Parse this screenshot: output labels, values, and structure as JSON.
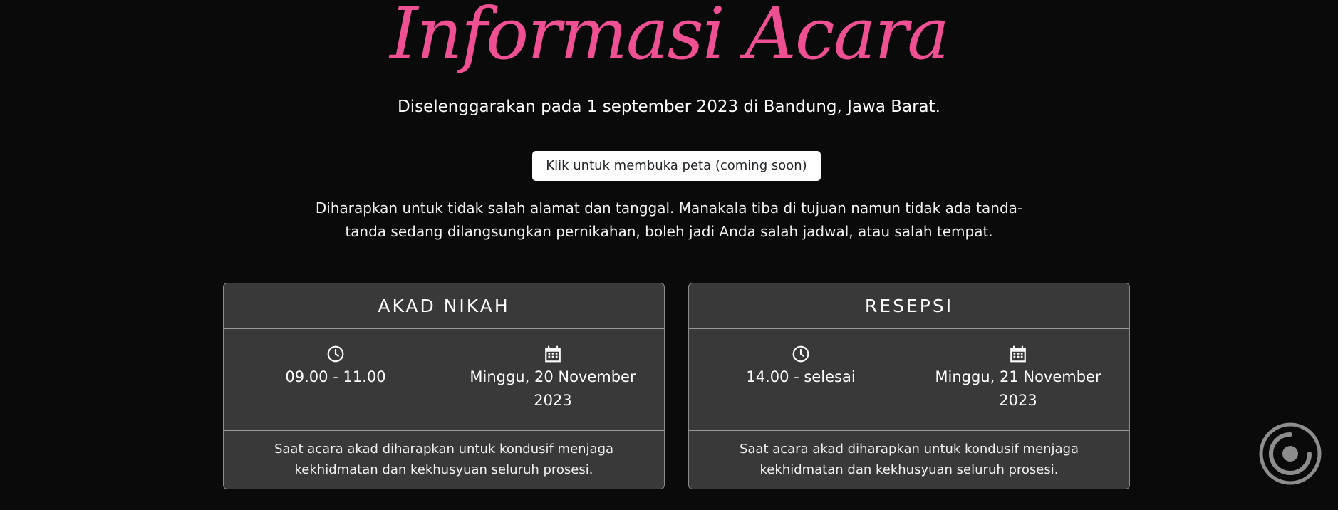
{
  "header": {
    "title": "Informasi Acara",
    "subtitle": "Diselenggarakan pada 1 september 2023 di Bandung, Jawa Barat."
  },
  "map_button": {
    "label": "Klik untuk membuka peta (coming soon)"
  },
  "note": "Diharapkan untuk tidak salah alamat dan tanggal. Manakala tiba di tujuan namun tidak ada tanda-tanda sedang dilangsungkan pernikahan, boleh jadi Anda salah jadwal, atau salah tempat.",
  "events": [
    {
      "title": "AKAD NIKAH",
      "time": "09.00 - 11.00",
      "date": "Minggu, 20 November 2023",
      "description": "Saat acara akad diharapkan untuk kondusif menjaga kekhidmatan dan kekhusyuan seluruh prosesi."
    },
    {
      "title": "RESEPSI",
      "time": "14.00 - selesai",
      "date": "Minggu, 21 November 2023",
      "description": "Saat acara akad diharapkan untuk kondusif menjaga kekhidmatan dan kekhusyuan seluruh prosesi."
    }
  ],
  "icons": {
    "time": "clock-icon",
    "date": "calendar-icon",
    "music": "music-disc-icon"
  },
  "colors": {
    "background": "#0b0a0a",
    "accent": "#ef4f93",
    "card": "#3a3939"
  }
}
